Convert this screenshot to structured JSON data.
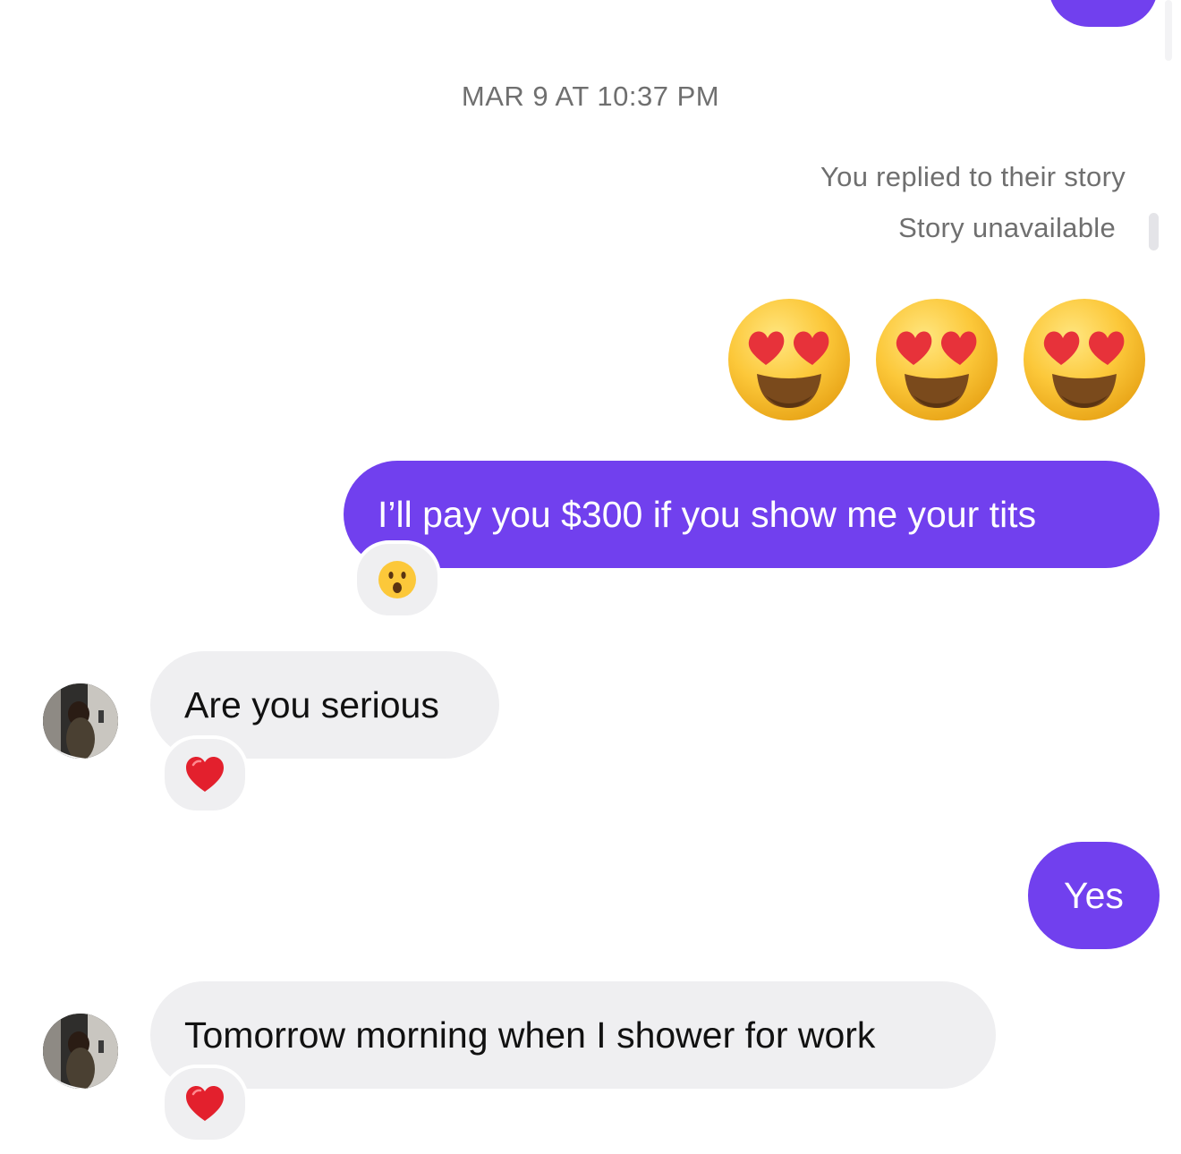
{
  "header": {
    "timestamp": "MAR 9 AT 10:37 PM"
  },
  "story": {
    "replied_label": "You replied to their story",
    "unavailable_label": "Story unavailable"
  },
  "messages": [
    {
      "direction": "sent",
      "type": "emoji",
      "content": "😍😍😍"
    },
    {
      "direction": "sent",
      "type": "text",
      "text": "I’ll pay you $300 if you show me your tits",
      "reaction": "hushed-face"
    },
    {
      "direction": "received",
      "type": "text",
      "text": "Are you serious",
      "reaction": "red-heart"
    },
    {
      "direction": "sent",
      "type": "text",
      "text": "Yes"
    },
    {
      "direction": "received",
      "type": "text",
      "text": "Tomorrow morning when I shower for work",
      "reaction": "red-heart"
    }
  ],
  "colors": {
    "sent_bubble": "#7140ee",
    "received_bubble": "#efeff1",
    "meta_text": "#6f6f6f"
  }
}
